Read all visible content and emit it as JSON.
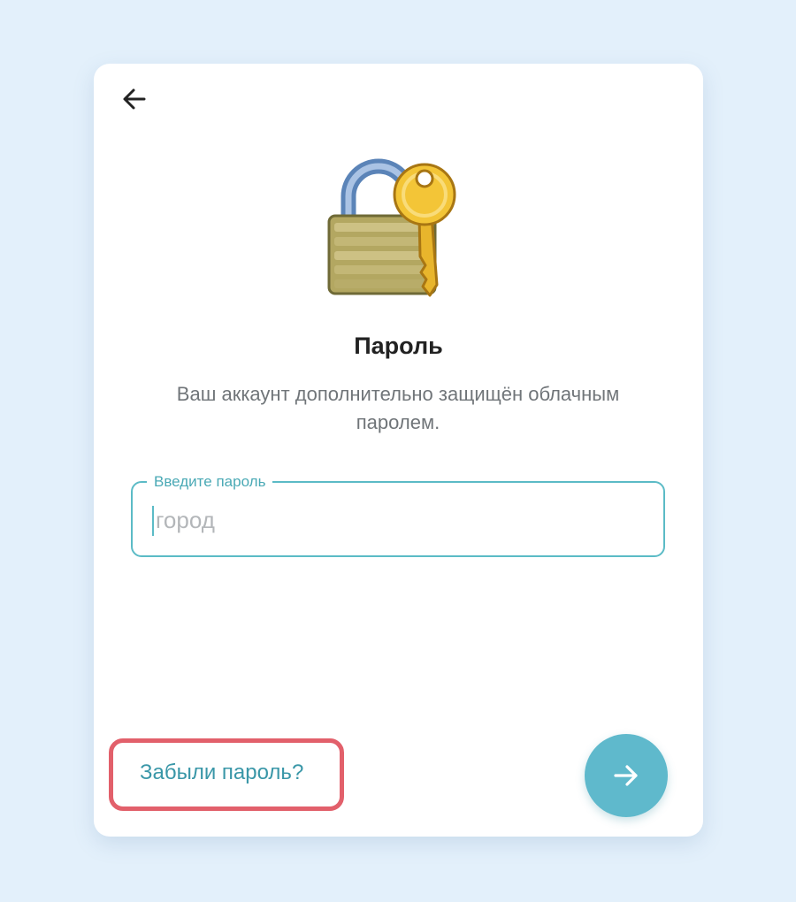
{
  "dialog": {
    "title": "Пароль",
    "subtitle": "Ваш аккаунт дополнительно защищён облачным паролем.",
    "illustration_icon": "padlock-and-key-icon"
  },
  "password_field": {
    "label": "Введите пароль",
    "placeholder": "город",
    "value": ""
  },
  "forgot_link": {
    "label": "Забыли пароль?"
  },
  "icons": {
    "back": "back-arrow-icon",
    "next": "forward-arrow-icon"
  },
  "colors": {
    "background": "#e3f0fb",
    "accent": "#5bbbc6",
    "link": "#3a97a8",
    "next_button": "#5fb9cc",
    "highlight": "#e2606b"
  }
}
